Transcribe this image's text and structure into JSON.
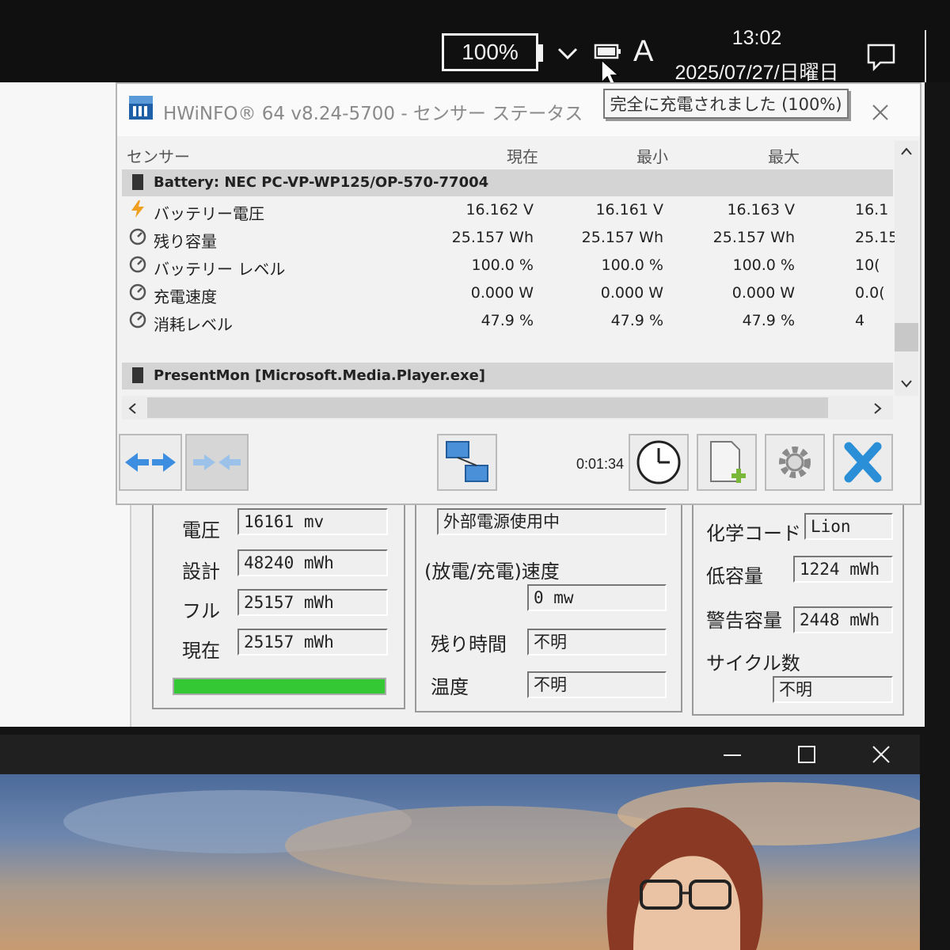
{
  "taskbar": {
    "battery_percent": "100%",
    "clock_time": "13:02",
    "clock_date": "2025/07/27/日曜日",
    "ime_mode": "A",
    "tooltip": "完全に充電されました (100%)"
  },
  "hwinfo": {
    "title": "HWiNFO® 64 v8.24-5700 - センサー ステータス",
    "columns": [
      "センサー",
      "現在",
      "最小",
      "最大"
    ],
    "groups": [
      {
        "name": "Battery: NEC  PC-VP-WP125/OP-570-77004",
        "rows": [
          {
            "name": "バッテリー電圧",
            "icon": "bolt-icon",
            "current": "16.162 V",
            "min": "16.161 V",
            "max": "16.163 V",
            "avg": "16.1"
          },
          {
            "name": "残り容量",
            "icon": "gauge-icon",
            "current": "25.157 Wh",
            "min": "25.157 Wh",
            "max": "25.157 Wh",
            "avg": "25.15"
          },
          {
            "name": "バッテリー レベル",
            "icon": "gauge-icon",
            "current": "100.0 %",
            "min": "100.0 %",
            "max": "100.0 %",
            "avg": "10("
          },
          {
            "name": "充電速度",
            "icon": "gauge-icon",
            "current": "0.000 W",
            "min": "0.000 W",
            "max": "0.000 W",
            "avg": "0.0("
          },
          {
            "name": "消耗レベル",
            "icon": "gauge-icon",
            "current": "47.9 %",
            "min": "47.9 %",
            "max": "47.9 %",
            "avg": "4"
          }
        ]
      },
      {
        "name": "PresentMon [Microsoft.Media.Player.exe]",
        "rows": []
      }
    ],
    "elapsed": "0:01:34"
  },
  "battery_app": {
    "left": [
      {
        "label": "電圧",
        "value": "16161 mv"
      },
      {
        "label": "設計",
        "value": "48240 mWh"
      },
      {
        "label": "フル",
        "value": "25157 mWh"
      },
      {
        "label": "現在",
        "value": "25157 mWh"
      }
    ],
    "charge_fraction": 1.0,
    "middle": {
      "power_source": "外部電源使用中",
      "rate_label": "(放電/充電)速度",
      "rate_value": "0 mw",
      "remaining_label": "残り時間",
      "remaining_value": "不明",
      "temp_label": "温度",
      "temp_value": "不明"
    },
    "right": [
      {
        "label": "化学コード",
        "value": "Lion"
      },
      {
        "label": "低容量",
        "value": "1224 mWh"
      },
      {
        "label": "警告容量",
        "value": "2448 mWh"
      },
      {
        "label": "サイクル数",
        "value": "不明"
      }
    ]
  },
  "colors": {
    "charge_bar": "#34c934",
    "close_blue": "#2a8fd6",
    "arrow_blue": "#3d8ee0"
  }
}
